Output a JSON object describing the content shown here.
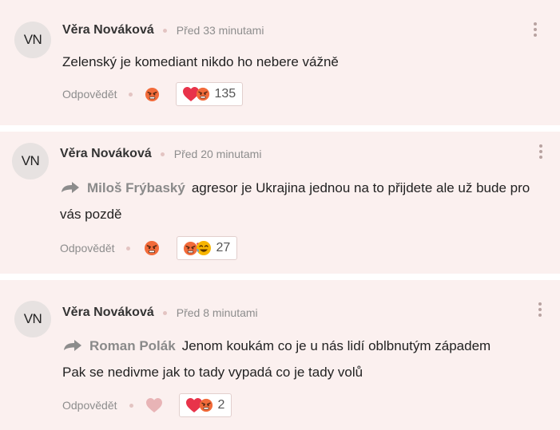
{
  "comments": [
    {
      "initials": "VN",
      "author": "Věra Nováková",
      "time": "Před 33 minutami",
      "reply_to": "",
      "text": "Zelenský je komediant nikdo ho nebere vážně",
      "reply_label": "Odpovědět",
      "my_reaction": "angry-face-icon",
      "reactions": [
        "heart-icon",
        "angry-face-icon"
      ],
      "reaction_count": "135"
    },
    {
      "initials": "VN",
      "author": "Věra Nováková",
      "time": "Před 20 minutami",
      "reply_to": "Miloš Frýbaský",
      "text": "agresor je Ukrajina jednou na to přijdete ale už bude pro vás pozdě",
      "reply_label": "Odpovědět",
      "my_reaction": "angry-face-icon",
      "reactions": [
        "angry-face-icon",
        "laughing-face-icon"
      ],
      "reaction_count": "27"
    },
    {
      "initials": "VN",
      "author": "Věra Nováková",
      "time": "Před 8 minutami",
      "reply_to": "Roman Polák",
      "text": "Jenom koukám co je u nás lidí oblbnutým západem Pak se nedivme jak to tady vypadá co je tady volů",
      "reply_label": "Odpovědět",
      "my_reaction": "heart-outline-icon",
      "reactions": [
        "heart-icon",
        "angry-face-icon"
      ],
      "reaction_count": "2"
    }
  ],
  "colors": {
    "card_background": "#fbf0ef",
    "heart": "#e8334a",
    "angry_face": "#f26b3a"
  }
}
